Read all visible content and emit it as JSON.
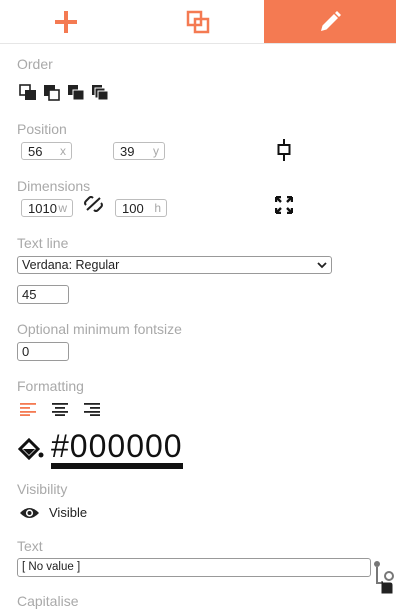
{
  "tabs": [
    {
      "name": "add",
      "icon": "plus-icon"
    },
    {
      "name": "layers",
      "icon": "layers-icon"
    },
    {
      "name": "edit",
      "icon": "pencil-icon",
      "active": true
    }
  ],
  "sections": {
    "order": "Order",
    "position": "Position",
    "dimensions": "Dimensions",
    "text_line": "Text line",
    "optional_min_fontsize": "Optional minimum fontsize",
    "formatting": "Formatting",
    "visibility": "Visibility",
    "text": "Text",
    "capitalise": "Capitalise"
  },
  "position": {
    "x": "56",
    "x_unit": "x",
    "y": "39",
    "y_unit": "y"
  },
  "dimensions": {
    "w": "1010",
    "w_unit": "w",
    "h": "100",
    "h_unit": "h"
  },
  "font_select": "Verdana: Regular",
  "font_size": "45",
  "min_fontsize": "0",
  "color_hex": "#000000",
  "visibility_label": "Visible",
  "text_value": "[ No value ]",
  "colors": {
    "accent": "#f47a52",
    "label": "#a9a9a9",
    "icon": "#222222"
  }
}
